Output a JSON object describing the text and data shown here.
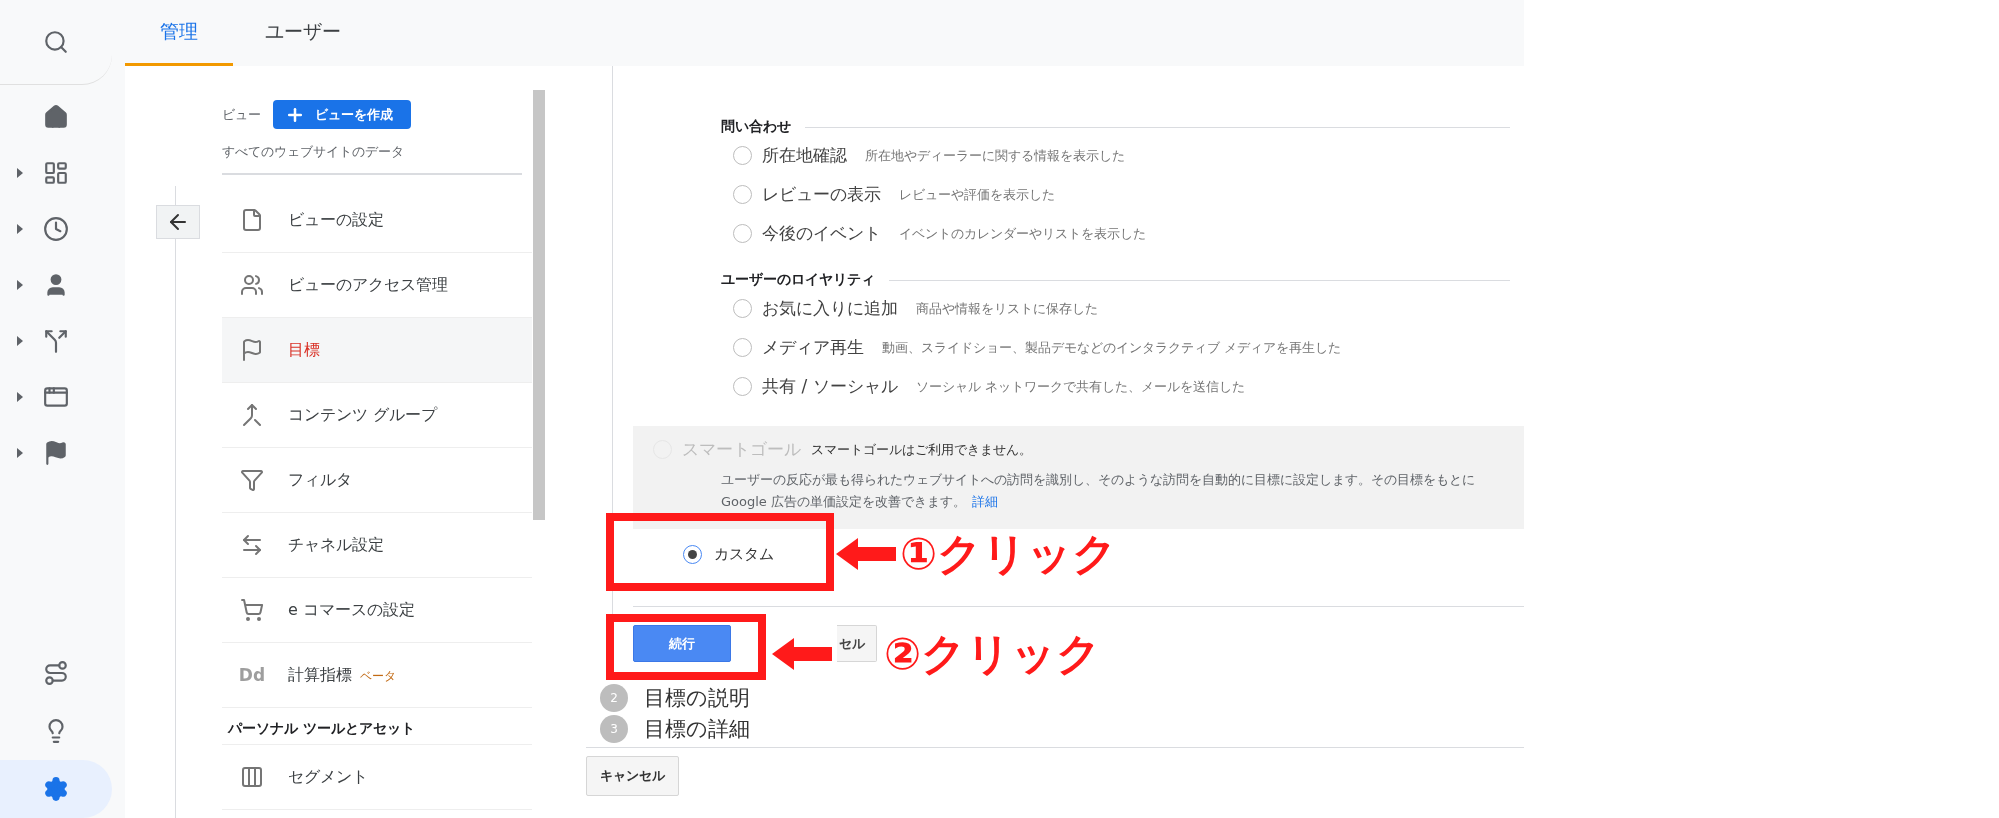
{
  "rail": {
    "top": [
      {
        "kind": "search",
        "expandable": false,
        "selected": false
      },
      {
        "kind": "home",
        "expandable": false,
        "selected": false
      },
      {
        "kind": "dashboard",
        "expandable": true,
        "selected": false
      },
      {
        "kind": "clock",
        "expandable": true,
        "selected": false
      },
      {
        "kind": "person",
        "expandable": true,
        "selected": false
      },
      {
        "kind": "split",
        "expandable": true,
        "selected": false
      },
      {
        "kind": "window",
        "expandable": true,
        "selected": false
      },
      {
        "kind": "flag",
        "expandable": true,
        "selected": false
      }
    ],
    "bottom": [
      {
        "kind": "route",
        "expandable": false,
        "selected": false
      },
      {
        "kind": "bulb",
        "expandable": false,
        "selected": false
      },
      {
        "kind": "gear",
        "expandable": false,
        "selected": true
      }
    ]
  },
  "tabs": [
    {
      "label": "管理",
      "selected": true
    },
    {
      "label": "ユーザー",
      "selected": false
    }
  ],
  "view_panel": {
    "label": "ビュー",
    "create_button": "ビューを作成",
    "view_name": "すべてのウェブサイトのデータ",
    "items": [
      {
        "kind": "file",
        "label": "ビューの設定",
        "selected": false
      },
      {
        "kind": "people",
        "label": "ビューのアクセス管理",
        "selected": false
      },
      {
        "kind": "flag",
        "label": "目標",
        "selected": true
      },
      {
        "kind": "merge",
        "label": "コンテンツ グループ",
        "selected": false
      },
      {
        "kind": "filter",
        "label": "フィルタ",
        "selected": false
      },
      {
        "kind": "channel",
        "label": "チャネル設定",
        "selected": false
      },
      {
        "kind": "cart",
        "label": "e コマースの設定",
        "selected": false
      },
      {
        "kind": "text",
        "icon_text": "Dd",
        "label": "計算指標",
        "badge": "ベータ",
        "selected": false
      }
    ],
    "section": "パーソナル ツールとアセット",
    "section_items": [
      {
        "kind": "segment",
        "label": "セグメント",
        "selected": false
      }
    ]
  },
  "goal_setup": {
    "groups": [
      {
        "title": "問い合わせ",
        "options": [
          {
            "label": "所在地確認",
            "description": "所在地やディーラーに関する情報を表示した",
            "selected": false
          },
          {
            "label": "レビューの表示",
            "description": "レビューや評価を表示した",
            "selected": false
          },
          {
            "label": "今後のイベント",
            "description": "イベントのカレンダーやリストを表示した",
            "selected": false
          }
        ]
      },
      {
        "title": "ユーザーのロイヤリティ",
        "options": [
          {
            "label": "お気に入りに追加",
            "description": "商品や情報をリストに保存した",
            "selected": false
          },
          {
            "label": "メディア再生",
            "description": "動画、スライドショー、製品デモなどのインタラクティブ メディアを再生した",
            "selected": false
          },
          {
            "label": "共有 / ソーシャル",
            "description": "ソーシャル ネットワークで共有した、メールを送信した",
            "selected": false
          }
        ]
      }
    ],
    "smart_goal": {
      "label": "スマートゴール",
      "status": "スマートゴールはご利用できません。",
      "description": "ユーザーの反応が最も得られたウェブサイトへの訪問を識別し、そのような訪問を自動的に目標に設定します。その目標をもとに Google 広告の単価設定を改善できます。",
      "link": "詳細",
      "disabled": true,
      "selected": false
    },
    "custom": {
      "label": "カスタム",
      "selected": true
    },
    "continue_button": "続行",
    "cancel_button": "セル"
  },
  "steps": [
    {
      "number": "2",
      "label": "目標の説明"
    },
    {
      "number": "3",
      "label": "目標の詳細"
    }
  ],
  "cancel_button": "キャンセル",
  "annotations": [
    {
      "text": "①クリック"
    },
    {
      "text": "②クリック"
    }
  ]
}
